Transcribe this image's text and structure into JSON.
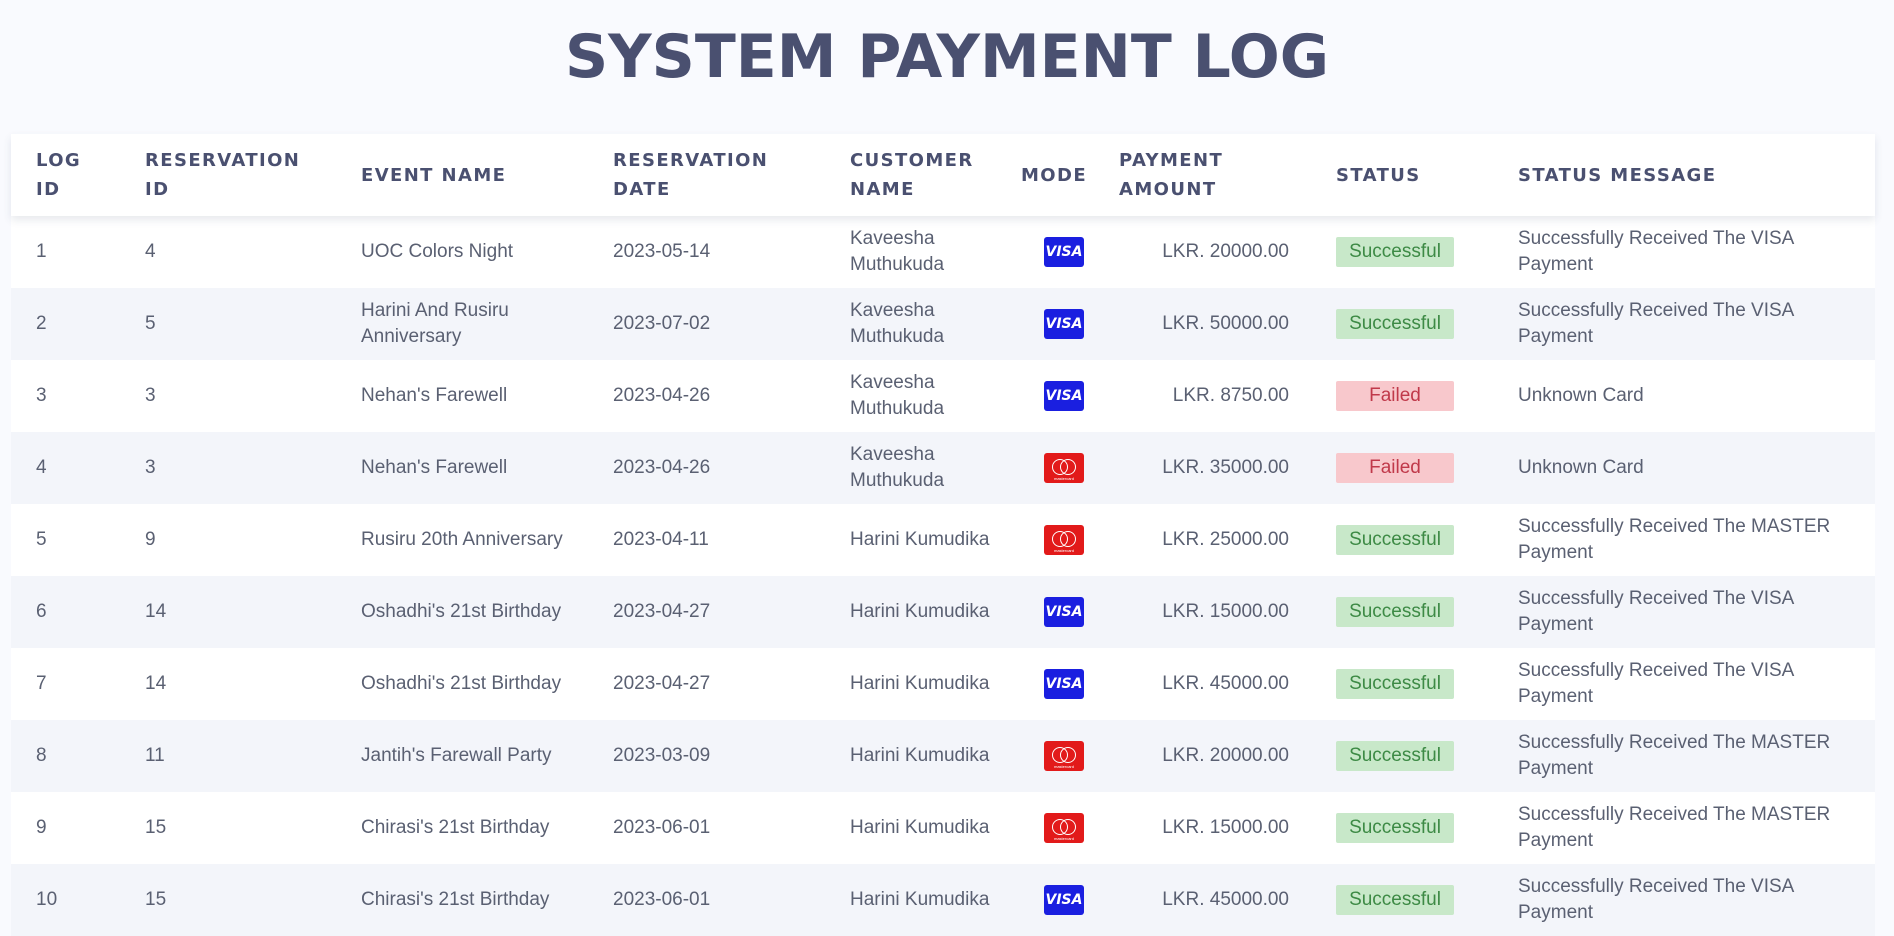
{
  "page": {
    "title": "SYSTEM PAYMENT LOG"
  },
  "table": {
    "headers": [
      "LOG ID",
      "RESERVATION ID",
      "EVENT NAME",
      "RESERVATION DATE",
      "CUSTOMER NAME",
      "MODE",
      "PAYMENT AMOUNT",
      "STATUS",
      "STATUS MESSAGE"
    ],
    "rows": [
      {
        "log_id": "1",
        "reservation_id": "4",
        "event_name": "UOC Colors Night",
        "reservation_date": "2023-05-14",
        "customer_name": "Kaveesha Muthukuda",
        "mode": "visa",
        "amount": "LKR. 20000.00",
        "status": "Successful",
        "message": "Successfully Received The VISA Payment"
      },
      {
        "log_id": "2",
        "reservation_id": "5",
        "event_name": "Harini And Rusiru Anniversary",
        "reservation_date": "2023-07-02",
        "customer_name": "Kaveesha Muthukuda",
        "mode": "visa",
        "amount": "LKR. 50000.00",
        "status": "Successful",
        "message": "Successfully Received The VISA Payment"
      },
      {
        "log_id": "3",
        "reservation_id": "3",
        "event_name": "Nehan's Farewell",
        "reservation_date": "2023-04-26",
        "customer_name": "Kaveesha Muthukuda",
        "mode": "visa",
        "amount": "LKR. 8750.00",
        "status": "Failed",
        "message": "Unknown Card"
      },
      {
        "log_id": "4",
        "reservation_id": "3",
        "event_name": "Nehan's Farewell",
        "reservation_date": "2023-04-26",
        "customer_name": "Kaveesha Muthukuda",
        "mode": "mastercard",
        "amount": "LKR. 35000.00",
        "status": "Failed",
        "message": "Unknown Card"
      },
      {
        "log_id": "5",
        "reservation_id": "9",
        "event_name": "Rusiru 20th Anniversary",
        "reservation_date": "2023-04-11",
        "customer_name": "Harini Kumudika",
        "mode": "mastercard",
        "amount": "LKR. 25000.00",
        "status": "Successful",
        "message": "Successfully Received The MASTER Payment"
      },
      {
        "log_id": "6",
        "reservation_id": "14",
        "event_name": "Oshadhi's 21st Birthday",
        "reservation_date": "2023-04-27",
        "customer_name": "Harini Kumudika",
        "mode": "visa",
        "amount": "LKR. 15000.00",
        "status": "Successful",
        "message": "Successfully Received The VISA Payment"
      },
      {
        "log_id": "7",
        "reservation_id": "14",
        "event_name": "Oshadhi's 21st Birthday",
        "reservation_date": "2023-04-27",
        "customer_name": "Harini Kumudika",
        "mode": "visa",
        "amount": "LKR. 45000.00",
        "status": "Successful",
        "message": "Successfully Received The VISA Payment"
      },
      {
        "log_id": "8",
        "reservation_id": "11",
        "event_name": "Jantih's Farewall Party",
        "reservation_date": "2023-03-09",
        "customer_name": "Harini Kumudika",
        "mode": "mastercard",
        "amount": "LKR. 20000.00",
        "status": "Successful",
        "message": "Successfully Received The MASTER Payment"
      },
      {
        "log_id": "9",
        "reservation_id": "15",
        "event_name": "Chirasi's 21st Birthday",
        "reservation_date": "2023-06-01",
        "customer_name": "Harini Kumudika",
        "mode": "mastercard",
        "amount": "LKR. 15000.00",
        "status": "Successful",
        "message": "Successfully Received The MASTER Payment"
      },
      {
        "log_id": "10",
        "reservation_id": "15",
        "event_name": "Chirasi's 21st Birthday",
        "reservation_date": "2023-06-01",
        "customer_name": "Harini Kumudika",
        "mode": "visa",
        "amount": "LKR. 45000.00",
        "status": "Successful",
        "message": "Successfully Received The VISA Payment"
      }
    ]
  },
  "icons": {
    "visa": {
      "label": "VISA",
      "color": "#1a1fe0"
    },
    "mastercard": {
      "label": "mastercard",
      "color": "#e21a1a"
    }
  },
  "colors": {
    "success_bg": "#c8e8c9",
    "success_text": "#3d8a45",
    "failed_bg": "#f8c8cc",
    "failed_text": "#c0394a"
  }
}
